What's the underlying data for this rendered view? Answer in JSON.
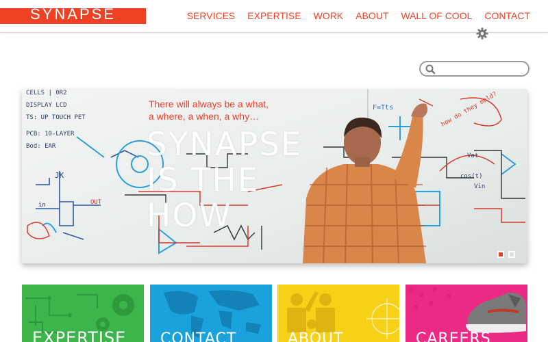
{
  "brand": {
    "logo_text": "SYNAPSE",
    "accent": "#ef4123"
  },
  "nav": {
    "items": [
      {
        "label": "SERVICES"
      },
      {
        "label": "EXPERTISE"
      },
      {
        "label": "WORK"
      },
      {
        "label": "ABOUT"
      },
      {
        "label": "WALL OF COOL"
      },
      {
        "label": "CONTACT"
      }
    ]
  },
  "settings": {
    "icon": "gear-icon"
  },
  "search": {
    "placeholder": "",
    "value": "",
    "icon": "search-icon"
  },
  "hero": {
    "tagline_line1": "There will always be a what,",
    "tagline_line2": "a where, a when, a why…",
    "headline_line1": "SYNAPSE",
    "headline_line2": "IS THE",
    "headline_line3": "HOW",
    "slide_count": 2,
    "active_slide": 1,
    "whiteboard_text": {
      "notes1": "CELLS | 0R2",
      "notes2": "DISPLAY LCD",
      "notes3": "TS: UP TOUCH PET",
      "notes4": "PCB: 10-LAYER",
      "notes5": "Bod: EAR",
      "jk": "JK",
      "in": "in",
      "out": "OUT",
      "formula": "F=Tts",
      "question": "how do they mold?",
      "vot": "Vot",
      "cos": "cos(t)",
      "vin": "Vin"
    }
  },
  "tiles": [
    {
      "label": "EXPERTISE",
      "color": "#3cb54a"
    },
    {
      "label": "CONTACT",
      "color": "#19a2dc"
    },
    {
      "label": "ABOUT",
      "color": "#f7d117"
    },
    {
      "label": "CAREERS",
      "color": "#ec2a86"
    }
  ]
}
